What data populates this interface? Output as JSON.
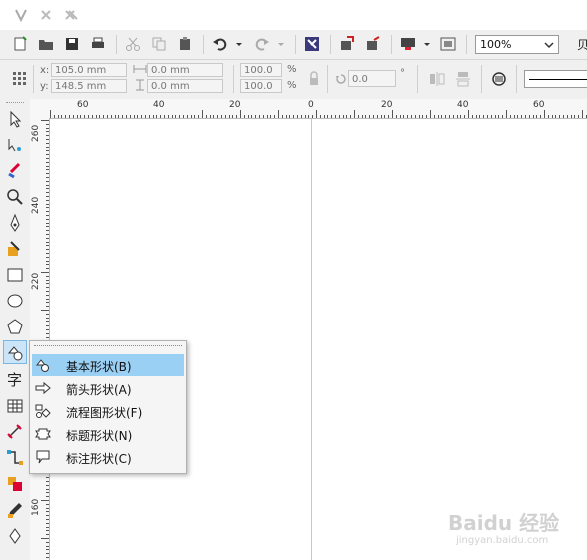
{
  "toolbar": {
    "zoom_value": "100%",
    "zoom_overflow": "贝"
  },
  "propbar": {
    "x_label": "x:",
    "y_label": "y:",
    "x_value": "105.0 mm",
    "y_value": "148.5 mm",
    "width_value": "0.0 mm",
    "height_value": "0.0 mm",
    "scale_w": "100.0",
    "scale_h": "100.0",
    "pct": "%",
    "rotation": "0.0",
    "deg": "°"
  },
  "ruler_top": [
    "60",
    "40",
    "20",
    "0",
    "20",
    "40",
    "60"
  ],
  "ruler_left": [
    "260",
    "240",
    "220",
    "160"
  ],
  "toolbox": {
    "text_tool_glyph": "字"
  },
  "menu": {
    "items": [
      {
        "label": "基本形状(B)",
        "shortcut": "B"
      },
      {
        "label": "箭头形状(A)",
        "shortcut": "A"
      },
      {
        "label": "流程图形状(F)",
        "shortcut": "F"
      },
      {
        "label": "标题形状(N)",
        "shortcut": "N"
      },
      {
        "label": "标注形状(C)",
        "shortcut": "C"
      }
    ],
    "selected_index": 0
  },
  "watermark": {
    "text": "Baidu 经验",
    "sub": "jingyan.baidu.com"
  }
}
